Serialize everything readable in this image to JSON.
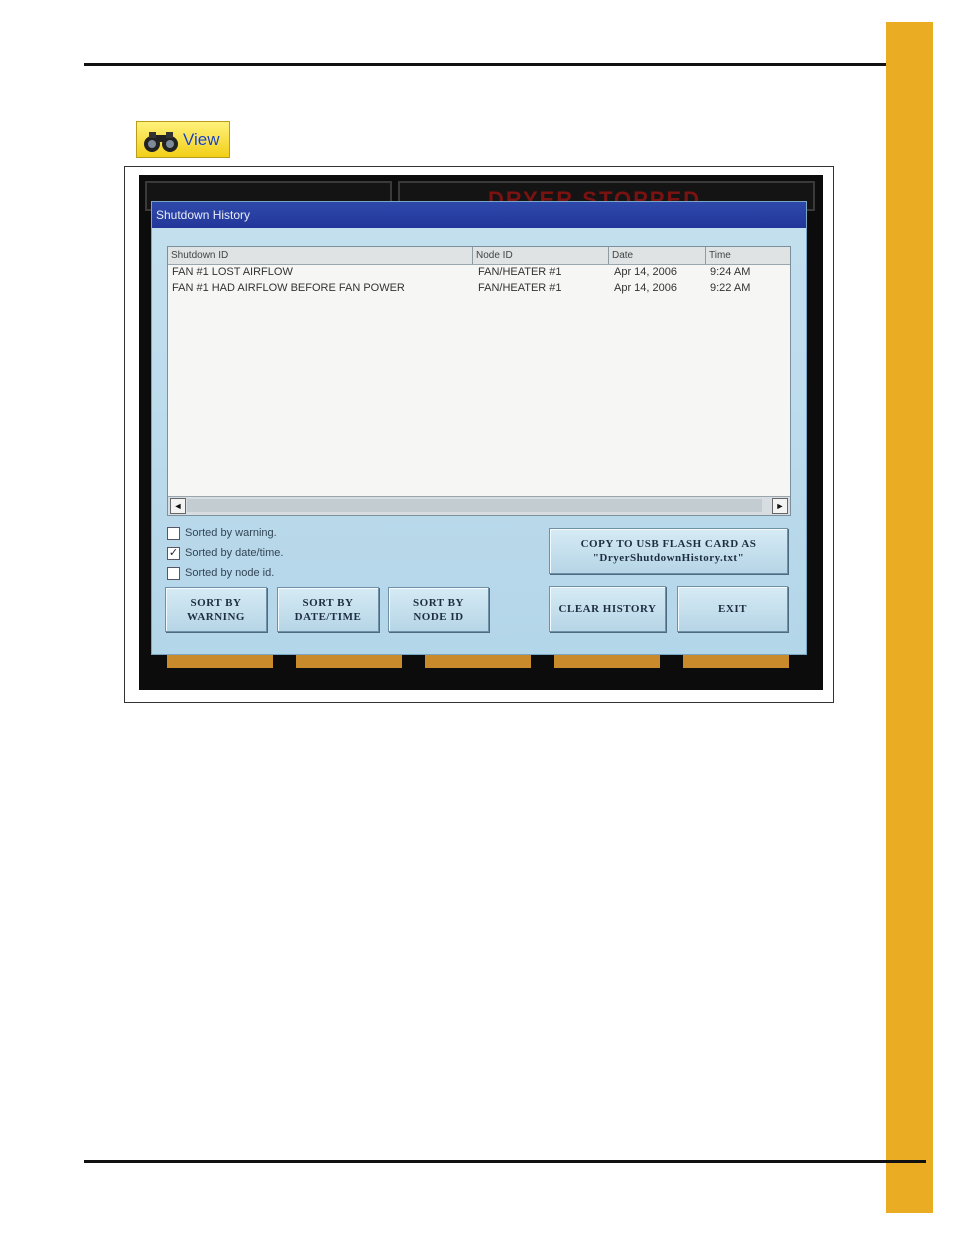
{
  "view_badge": {
    "label": "View",
    "icon": "binoculars-icon"
  },
  "screen": {
    "header_status": "DRYER STOPPED",
    "dialog": {
      "title": "Shutdown History",
      "columns": [
        "Shutdown ID",
        "Node ID",
        "Date",
        "Time"
      ],
      "rows": [
        {
          "shutdown_id": "FAN #1 LOST AIRFLOW",
          "node_id": "FAN/HEATER #1",
          "date": "Apr 14, 2006",
          "time": "9:24 AM"
        },
        {
          "shutdown_id": "FAN #1 HAD AIRFLOW BEFORE FAN POWER",
          "node_id": "FAN/HEATER #1",
          "date": "Apr 14, 2006",
          "time": "9:22 AM"
        }
      ],
      "scroll_left": "◄",
      "scroll_right": "►",
      "sort_options": [
        {
          "label": "Sorted by warning.",
          "checked": false
        },
        {
          "label": "Sorted by date/time.",
          "checked": true
        },
        {
          "label": "Sorted by node id.",
          "checked": false
        }
      ],
      "check_mark": "✓",
      "buttons": {
        "sort_warning": [
          "SORT BY",
          "WARNING"
        ],
        "sort_datetime": [
          "SORT BY",
          "DATE/TIME"
        ],
        "sort_node": [
          "SORT BY",
          "NODE ID"
        ],
        "copy_usb": [
          "COPY TO USB FLASH CARD AS",
          "\"DryerShutdownHistory.txt\""
        ],
        "clear_history": "CLEAR HISTORY",
        "exit": "EXIT"
      }
    }
  },
  "colors": {
    "side_tab": "#e9ac22",
    "title_bar": "#2e49ab",
    "dialog_bg": "#c4e0ef"
  }
}
